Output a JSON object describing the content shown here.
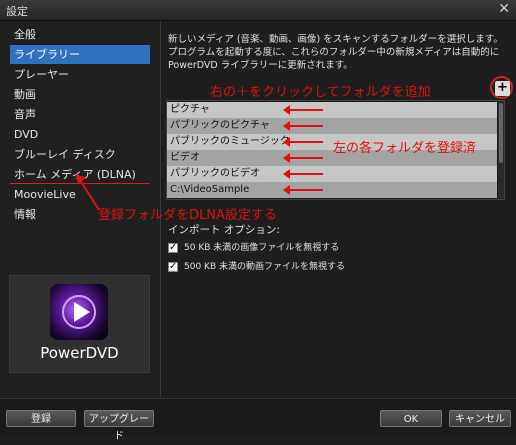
{
  "window": {
    "title": "設定",
    "close_glyph": "✕"
  },
  "sidebar": {
    "items": [
      {
        "label": "全般"
      },
      {
        "label": "ライブラリー"
      },
      {
        "label": "プレーヤー"
      },
      {
        "label": "動画"
      },
      {
        "label": "音声"
      },
      {
        "label": "DVD"
      },
      {
        "label": "ブルーレイ ディスク"
      },
      {
        "label": "ホーム メディア (DLNA)"
      },
      {
        "label": "MoovieLive"
      },
      {
        "label": "情報"
      }
    ],
    "active_index": 1
  },
  "logo": {
    "text": "PowerDVD"
  },
  "main": {
    "description": "新しいメディア (音楽、動画、画像) をスキャンするフォルダーを選択します。プログラムを起動する度に、これらのフォルダー中の新規メディアは自動的に PowerDVD ライブラリーに更新されます。",
    "add_button": "+",
    "folders": [
      "ピクチャ",
      "パブリックのピクチャ",
      "パブリックのミュージック",
      "ビデオ",
      "パブリックのビデオ",
      "C:\\VideoSample"
    ],
    "import_options_label": "インポート オプション:",
    "checkboxes": [
      {
        "label": "50 KB 未満の画像ファイルを無視する",
        "checked": true
      },
      {
        "label": "500 KB 未満の動画ファイルを無視する",
        "checked": true
      }
    ]
  },
  "annotations": {
    "add_folder": "右の＋をクリックしてフォルダを追加",
    "registered": "左の各フォルダを登録済",
    "dlna": "登録フォルダをDLNA設定する"
  },
  "buttons": {
    "register": "登録",
    "upgrade": "アップグレード",
    "ok": "OK",
    "cancel": "キャンセル"
  },
  "colors": {
    "accent": "#2f73c0",
    "annotation": "#e01010"
  }
}
